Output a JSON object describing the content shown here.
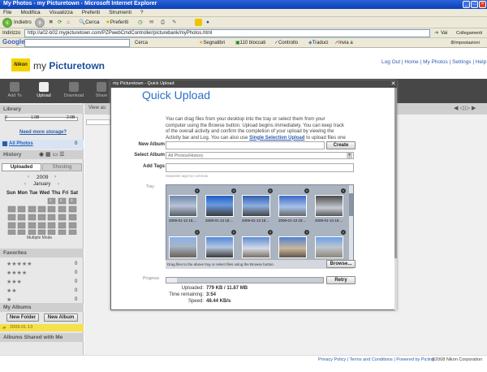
{
  "window": {
    "title": "My Photos - my Picturetown - Microsoft Internet Explorer"
  },
  "menubar": {
    "items": [
      "File",
      "Modifica",
      "Visualizza",
      "Preferiti",
      "Strumenti",
      "?"
    ]
  },
  "toolbar": {
    "back": "Indietro",
    "search": "Cerca",
    "favorites": "Preferiti"
  },
  "address": {
    "label": "Indirizzo",
    "url": "http://a02-b02.mypicturetown.com/PZPwebCmdController/picturebank/myPhotos.html",
    "go": "Vai",
    "links": "Collegamenti"
  },
  "googlebar": {
    "logo": "Google",
    "search": "Cerca",
    "bookmarks": "Segnalibri",
    "blocked": "110 bloccati",
    "check": "Controllo",
    "translate": "Traduci",
    "send": "Invia a",
    "settings": "Impostazioni"
  },
  "site": {
    "logo": "Nikon",
    "brand_prefix": "my ",
    "brand_name": "Picturetown",
    "toplinks": "Log Out | Home | My Photos | Settings | Help"
  },
  "nav": [
    "Add To",
    "Upload",
    "Download",
    "Share"
  ],
  "sidebar": {
    "library": "Library",
    "storage_min": "0",
    "storage_mid": "1.0B",
    "storage_max": "2.0B",
    "need_storage": "Need more storage?",
    "all_photos": "All Photos",
    "all_photos_count": "0",
    "history": "History",
    "tab_uploaded": "Uploaded",
    "tab_shooting": "Shooting",
    "year": "2009",
    "month": "January",
    "days": [
      "Sun",
      "Mon",
      "Tue",
      "Wed",
      "Thu",
      "Fri",
      "Sat"
    ],
    "cal_nums": [
      "1",
      "2",
      "3"
    ],
    "multiple_mode": "Multiple Mode",
    "favorites": "Favorites",
    "stars": [
      "★★★★★",
      "★★★★",
      "★★★",
      "★★",
      "★"
    ],
    "star_counts": [
      "0",
      "0",
      "0",
      "0",
      "0"
    ],
    "my_albums": "My Albums",
    "new_folder": "New Folder",
    "new_album": "New Album",
    "folder_item": "2009-01-13",
    "shared": "Albums Shared with Me"
  },
  "main": {
    "view_as": "View as:"
  },
  "footer": {
    "links": "Privacy Policy | Terms and Conditions | Powered by Picling",
    "copyright": "©2008 Nikon Corporation"
  },
  "dialog": {
    "title": "my Picturetown - Quick Upload",
    "heading": "Quick Upload",
    "instructions": "You can drag files from your desktop into the tray or select them from your computer using the Browse button. Upload begins immediately. You can keep track of the overall activity and confirm the completion of your upload by viewing the Activity bar and Log.",
    "instructions_b": "You can also use ",
    "instructions_link": "Single Selection Upload",
    "instructions_c": " to upload files one by one.",
    "new_album_label": "New Album",
    "create": "Create",
    "select_album_label": "Select Album",
    "select_album_value": "All Photos/History",
    "add_tags_label": "Add Tags",
    "tags_hint": "Separate tags by commas",
    "tray_label": "Tray",
    "thumb_captions": [
      "2009-01-13 15:...",
      "2009-01-13 15:...",
      "2009-01-13 15:...",
      "2009-01-13 15:...",
      "2009-01-13 15:..."
    ],
    "tray_hint": "Drag files to the above tray or select files using the Browse button.",
    "browse": "Browse...",
    "progress_label": "Progress",
    "progress_fraction": 0.066,
    "retry": "Retry",
    "uploaded_label": "Uploaded:",
    "uploaded_value": "779 KB / 11.87 MB",
    "remaining_label": "Time remaining:",
    "remaining_value": "3:54",
    "speed_label": "Speed:",
    "speed_value": "48.44 KB/s"
  }
}
